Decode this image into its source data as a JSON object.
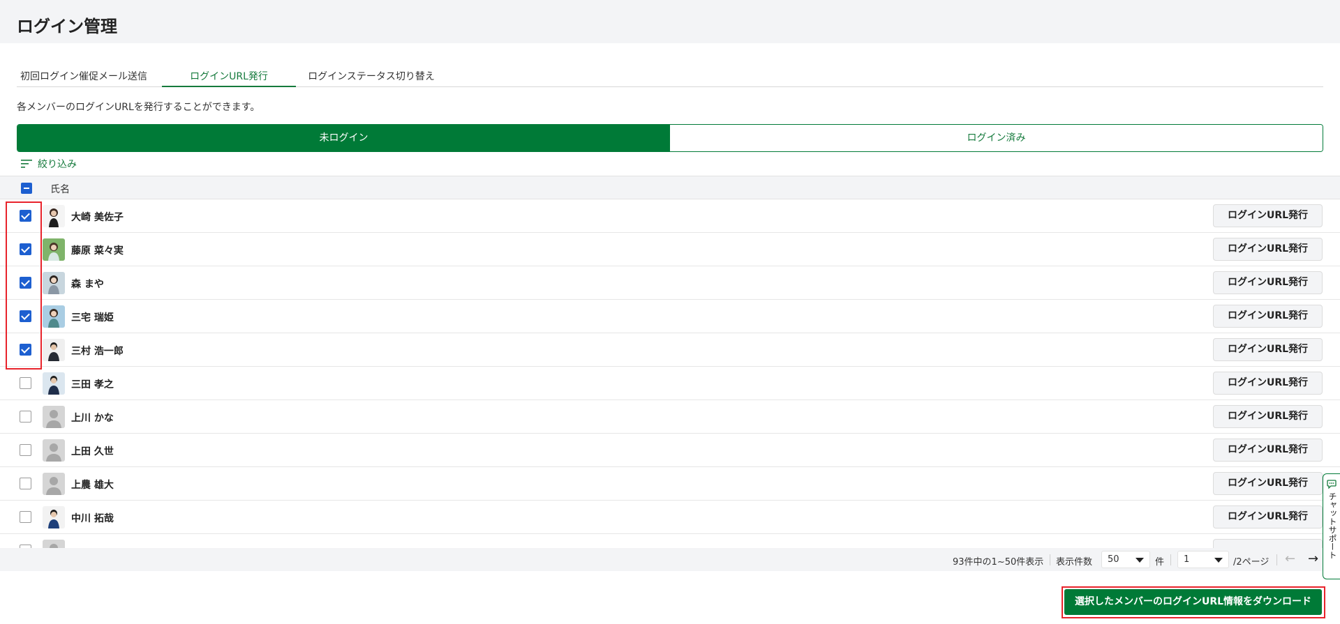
{
  "header": {
    "title": "ログイン管理"
  },
  "tabs": [
    {
      "label": "初回ログイン催促メール送信",
      "active": false
    },
    {
      "label": "ログインURL発行",
      "active": true
    },
    {
      "label": "ログインステータス切り替え",
      "active": false
    }
  ],
  "description": "各メンバーのログインURLを発行することができます。",
  "segments": {
    "left": "未ログイン",
    "right": "ログイン済み",
    "selected": "未ログイン"
  },
  "filter_label": "絞り込み",
  "table": {
    "header_label": "氏名",
    "row_button_label": "ログインURL発行",
    "rows": [
      {
        "name": "大崎 美佐子",
        "checked": true
      },
      {
        "name": "藤原 菜々実",
        "checked": true
      },
      {
        "name": "森 まや",
        "checked": true
      },
      {
        "name": "三宅 瑞姫",
        "checked": true
      },
      {
        "name": "三村 浩一郎",
        "checked": true
      },
      {
        "name": "三田 孝之",
        "checked": false
      },
      {
        "name": "上川 かな",
        "checked": false
      },
      {
        "name": "上田 久世",
        "checked": false
      },
      {
        "name": "上農 雄大",
        "checked": false
      },
      {
        "name": "中川 拓哉",
        "checked": false
      }
    ]
  },
  "pagination": {
    "summary": "93件中の1~50件表示",
    "per_page_label": "表示件数",
    "per_page_value": "50",
    "per_page_unit": "件",
    "page_value": "1",
    "page_total": "/2ページ"
  },
  "download_button": "選択したメンバーのログインURL情報をダウンロード",
  "chat_support": "チャットサポート",
  "colors": {
    "brand_green": "#007a37",
    "checkbox_blue": "#1d5fd0",
    "highlight_red": "#e8232b"
  }
}
